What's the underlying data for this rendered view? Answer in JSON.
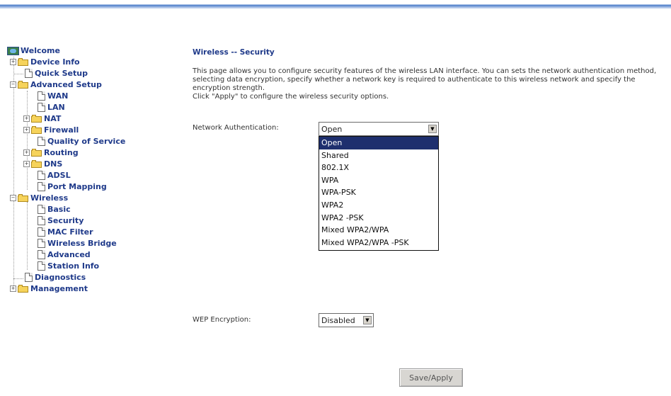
{
  "sidebar": {
    "items": [
      {
        "label": "Welcome",
        "icon": "globe-icon"
      },
      {
        "label": "Device Info",
        "icon": "folder-icon"
      },
      {
        "label": "Quick Setup",
        "icon": "page-icon"
      },
      {
        "label": "Advanced Setup",
        "icon": "folder-open-icon"
      },
      {
        "label": "WAN",
        "icon": "page-icon"
      },
      {
        "label": "LAN",
        "icon": "page-icon"
      },
      {
        "label": "NAT",
        "icon": "folder-icon"
      },
      {
        "label": "Firewall",
        "icon": "folder-icon"
      },
      {
        "label": "Quality of Service",
        "icon": "page-icon"
      },
      {
        "label": "Routing",
        "icon": "folder-icon"
      },
      {
        "label": "DNS",
        "icon": "folder-icon"
      },
      {
        "label": "ADSL",
        "icon": "page-icon"
      },
      {
        "label": "Port Mapping",
        "icon": "page-icon"
      },
      {
        "label": "Wireless",
        "icon": "folder-open-icon"
      },
      {
        "label": "Basic",
        "icon": "page-icon"
      },
      {
        "label": "Security",
        "icon": "page-icon"
      },
      {
        "label": "MAC Filter",
        "icon": "page-icon"
      },
      {
        "label": "Wireless Bridge",
        "icon": "page-icon"
      },
      {
        "label": "Advanced",
        "icon": "page-icon"
      },
      {
        "label": "Station Info",
        "icon": "page-icon"
      },
      {
        "label": "Diagnostics",
        "icon": "page-icon"
      },
      {
        "label": "Management",
        "icon": "folder-icon"
      }
    ]
  },
  "main": {
    "title": "Wireless -- Security",
    "description": "This page allows you to configure security features of the wireless LAN interface. You can sets the network authentication method, selecting data encryption, specify whether a network key is required to authenticate to this wireless network and specify the encryption strength.",
    "instruction": "Click \"Apply\" to configure the wireless security options.",
    "network_auth": {
      "label": "Network Authentication:",
      "value": "Open",
      "options": [
        "Open",
        "Shared",
        "802.1X",
        "WPA",
        "WPA-PSK",
        "WPA2",
        "WPA2 -PSK",
        "Mixed WPA2/WPA",
        "Mixed WPA2/WPA -PSK"
      ]
    },
    "wep": {
      "label": "WEP Encryption:",
      "value": "Disabled"
    },
    "save_label": "Save/Apply"
  },
  "colors": {
    "nav_text": "#1f3a8a",
    "selected_option_bg": "#1e2f6e",
    "top_bar": "#4a7bc8"
  }
}
